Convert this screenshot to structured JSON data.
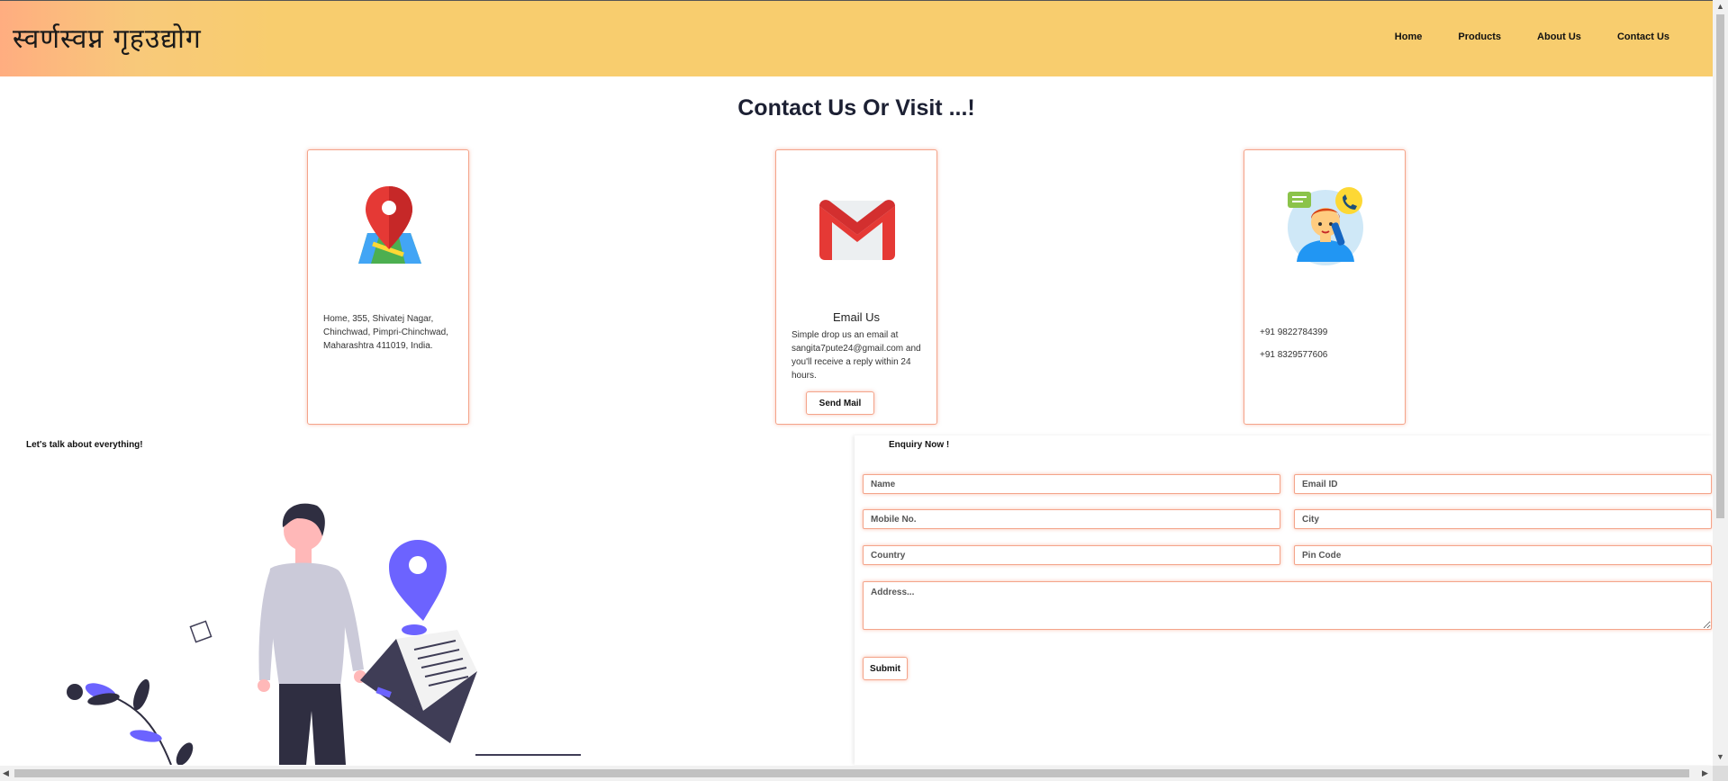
{
  "header": {
    "brand": "स्वर्णस्वप्न गृहउद्योग",
    "nav": [
      "Home",
      "Products",
      "About Us",
      "Contact Us"
    ]
  },
  "page": {
    "title": "Contact Us Or Visit ...!"
  },
  "cards": {
    "address": {
      "text": "Home, 355, Shivatej Nagar, Chinchwad, Pimpri-Chinchwad, Maharashtra 411019, India."
    },
    "email": {
      "title": "Email Us",
      "text": "Simple drop us an email at sangita7pute24@gmail.com and you'll receive a reply within 24 hours.",
      "button": "Send Mail"
    },
    "phone": {
      "phone1": "+91 9822784399",
      "phone2": "+91 8329577606"
    }
  },
  "left": {
    "tagline": "Let's talk about everything!"
  },
  "form": {
    "heading": "Enquiry Now !",
    "name": "Name",
    "email": "Email ID",
    "mobile": "Mobile No.",
    "city": "City",
    "country": "Country",
    "pincode": "Pin Code",
    "address": "Address...",
    "submit": "Submit"
  },
  "colors": {
    "accent_border": "#f4a48a",
    "header_bg": "#f8cd6e",
    "illustration_purple": "#6c63ff"
  }
}
